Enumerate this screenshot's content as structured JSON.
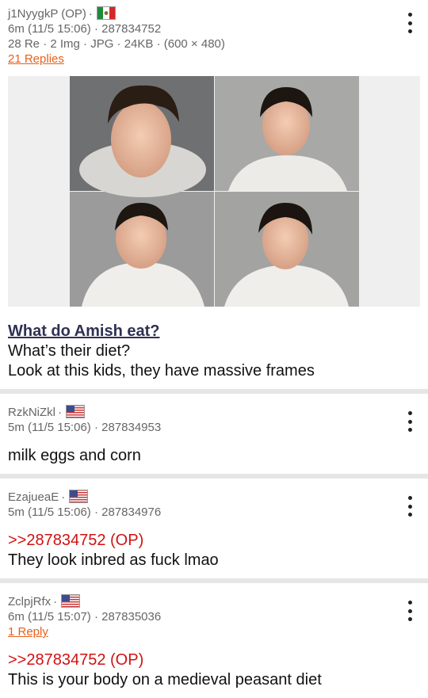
{
  "posts": [
    {
      "name": "j1NyygkP (OP)",
      "flag": "mexico-flag",
      "meta_line2": "6m (11/5 15:06) · 287834752",
      "meta_line3": "28 Re · 2 Img · JPG · 24KB · (600 × 480)",
      "replies": "21 Replies",
      "subject": "What do Amish eat?",
      "lines": [
        "What’s their diet?",
        "Look at this kids, they have massive frames"
      ]
    },
    {
      "name": "RzkNiZkl",
      "flag": "usa-flag",
      "meta_line2": "5m (11/5 15:06) · 287834953",
      "lines": [
        "milk eggs and corn"
      ]
    },
    {
      "name": "EzajueaE",
      "flag": "usa-flag",
      "meta_line2": "5m (11/5 15:06) · 287834976",
      "quote": ">>287834752 (OP)",
      "lines": [
        "They look inbred as fuck lmao"
      ]
    },
    {
      "name": "ZclpjRfx",
      "flag": "usa-flag",
      "meta_line2": "6m (11/5 15:07) · 287835036",
      "replies": "1 Reply",
      "quote": ">>287834752 (OP)",
      "lines": [
        "This is your body on a medieval peasant diet"
      ]
    }
  ],
  "colors": {
    "link": "#e8601c",
    "quote": "#d01212",
    "subject": "#2e3152"
  }
}
